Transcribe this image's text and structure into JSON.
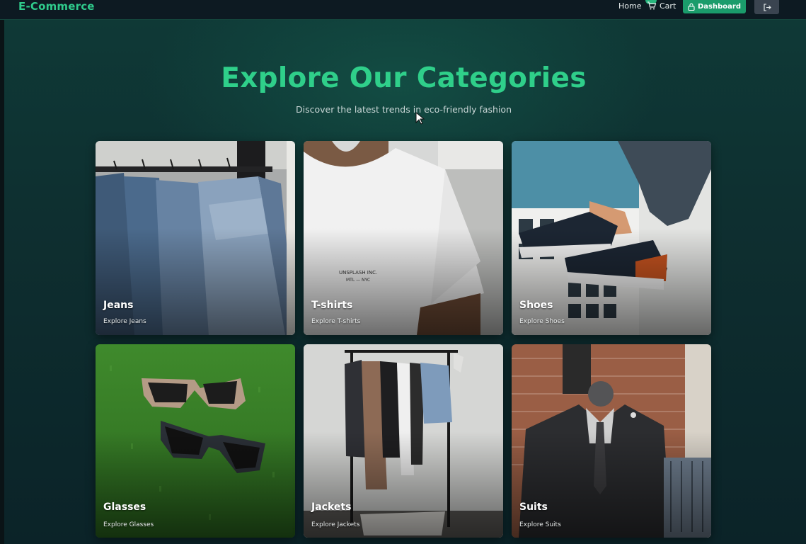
{
  "nav": {
    "brand": "E-Commerce",
    "home": "Home",
    "cart": "Cart",
    "dashboard": "Dashboard",
    "icons": [
      "cart-icon",
      "lock-icon",
      "logout-icon"
    ]
  },
  "hero": {
    "title": "Explore Our Categories",
    "subtitle": "Discover the latest trends in eco-friendly fashion"
  },
  "categories": [
    {
      "name": "Jeans",
      "link": "Explore Jeans"
    },
    {
      "name": "T-shirts",
      "link": "Explore T-shirts"
    },
    {
      "name": "Shoes",
      "link": "Explore Shoes"
    },
    {
      "name": "Glasses",
      "link": "Explore Glasses"
    },
    {
      "name": "Jackets",
      "link": "Explore Jackets"
    },
    {
      "name": "Suits",
      "link": "Explore Suits"
    }
  ],
  "colors": {
    "accent": "#2fcf8a",
    "button": "#1a9c6b",
    "background": "#0e2f30"
  }
}
